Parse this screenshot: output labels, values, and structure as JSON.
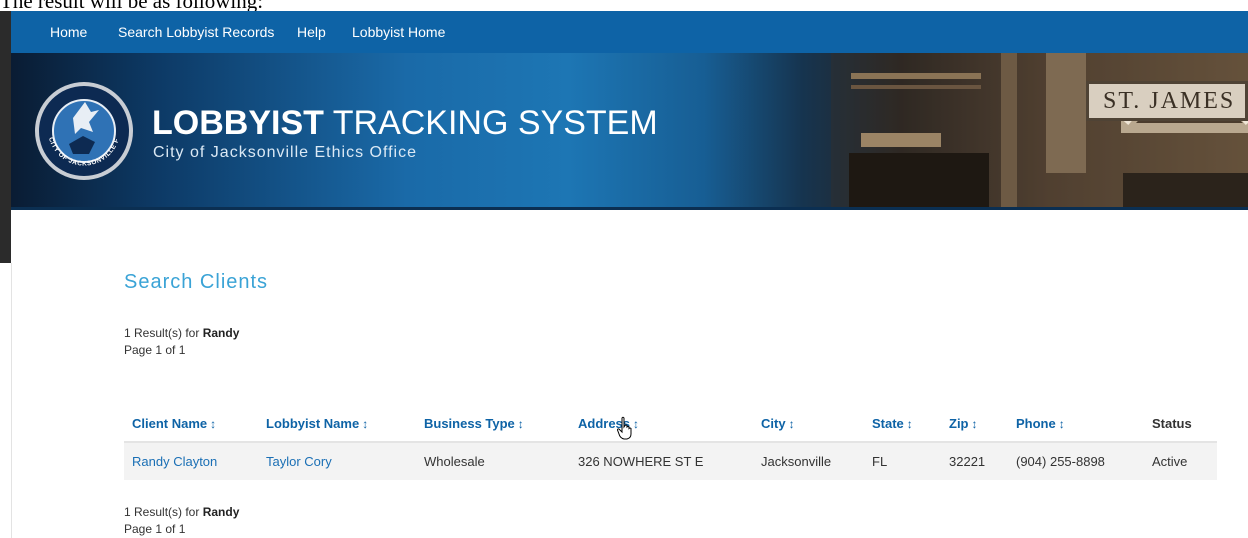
{
  "caption": "The result will be as following:",
  "nav": [
    "Home",
    "Search Lobbyist Records",
    "Help",
    "Lobbyist Home"
  ],
  "banner": {
    "title_bold": "LOBBYIST",
    "title_light": "TRACKING SYSTEM",
    "subtitle": "City of Jacksonville Ethics Office",
    "seal_text": "CITY OF JACKSONVILLE FLORIDA",
    "sign_text": "ST. JAMES"
  },
  "page": {
    "heading": "Search Clients",
    "results_prefix": "1 Result(s) for",
    "query": "Randy",
    "page_info": "Page 1 of 1"
  },
  "table": {
    "sort_icon": "↕",
    "columns": [
      "Client Name",
      "Lobbyist Name",
      "Business Type",
      "Address",
      "City",
      "State",
      "Zip",
      "Phone",
      "Status"
    ],
    "rows": [
      {
        "client": "Randy Clayton",
        "lobbyist": "Taylor Cory",
        "business_type": "Wholesale",
        "address": "326 NOWHERE ST E",
        "city": "Jacksonville",
        "state": "FL",
        "zip": "32221",
        "phone": "(904) 255-8898",
        "status": "Active"
      }
    ]
  },
  "colors": {
    "nav": "#0e63a6",
    "heading": "#3aa3d6",
    "link": "#1a6fb5"
  }
}
